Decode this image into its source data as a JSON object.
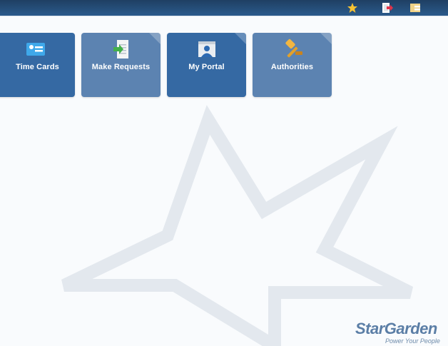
{
  "header": {
    "icons": [
      "star-icon",
      "logout-icon",
      "panel-icon"
    ],
    "background": "#2b5b8c"
  },
  "tiles": [
    {
      "label": "Time Cards",
      "icon": "id-card-icon",
      "color": "#3569a3"
    },
    {
      "label": "Make Requests",
      "icon": "document-arrow-icon",
      "color": "#5c83b1"
    },
    {
      "label": "My Portal",
      "icon": "portal-person-icon",
      "color": "#3569a3"
    },
    {
      "label": "Authorities",
      "icon": "gavel-icon",
      "color": "#5c83b1"
    }
  ],
  "brand": {
    "name": "StarGarden",
    "tagline": "Power Your People",
    "color": "#5b7ea6"
  },
  "watermark": {
    "icon": "star-watermark-icon",
    "color": "#e3e8ee"
  }
}
